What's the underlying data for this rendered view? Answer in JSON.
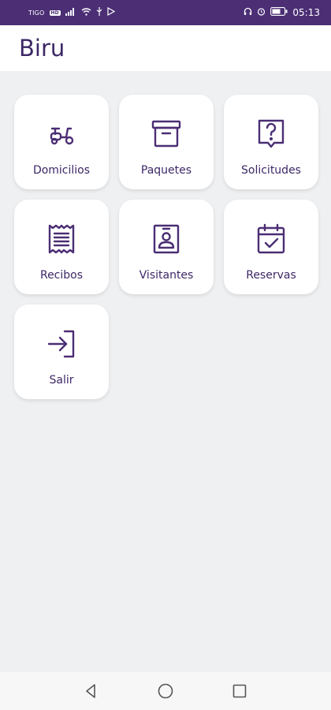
{
  "status_bar": {
    "carrier": "TIGO",
    "network_badge": "HD",
    "time": "05:13",
    "bg_color": "#4b2e74"
  },
  "app_bar": {
    "title": "Biru"
  },
  "menu": [
    {
      "label": "Domicilios",
      "icon": "scooter-icon"
    },
    {
      "label": "Paquetes",
      "icon": "archive-box-icon"
    },
    {
      "label": "Solicitudes",
      "icon": "help-request-icon"
    },
    {
      "label": "Recibos",
      "icon": "receipt-icon"
    },
    {
      "label": "Visitantes",
      "icon": "id-badge-icon"
    },
    {
      "label": "Reservas",
      "icon": "calendar-check-icon"
    },
    {
      "label": "Salir",
      "icon": "sign-in-arrow-icon"
    }
  ],
  "colors": {
    "accent": "#4b2e74",
    "text": "#3d2866",
    "background": "#eff0f2"
  },
  "nav_bar": {
    "icons": [
      "back-icon",
      "home-icon",
      "recents-icon"
    ]
  }
}
